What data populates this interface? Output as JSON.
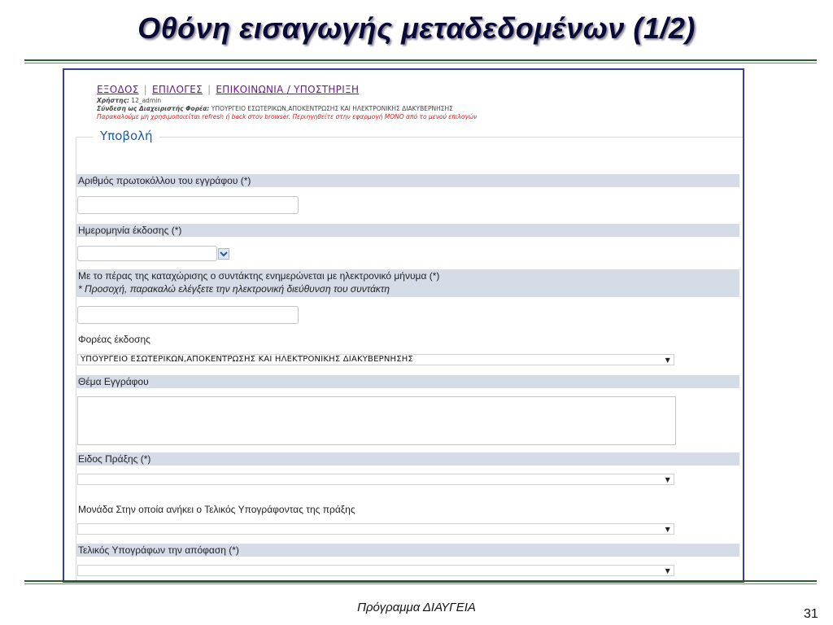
{
  "slide": {
    "title": "Οθόνη εισαγωγής μεταδεδομένων (1/2)",
    "footer": "Πρόγραμμα ΔΙΑΥΓΕΙΑ",
    "page_number": "31"
  },
  "nav": {
    "exit": "ΕΞΟΔΟΣ",
    "options": "ΕΠΙΛΟΓΕΣ",
    "support": "ΕΠΙΚΟΙΝΩΝΙΑ / ΥΠΟΣΤΗΡΙΞΗ",
    "separator": "|"
  },
  "info": {
    "user_label": "Χρήστης:",
    "user_value": "12_admin",
    "org_label": "Σύνδεση ως Διαχειριστής Φορέα:",
    "org_value": "ΥΠΟΥΡΓΕΙΟ ΕΣΩΤΕΡΙΚΩΝ,ΑΠΟΚΕΝΤΡΩΣΗΣ ΚΑΙ ΗΛΕΚΤΡΟΝΙΚΗΣ ΔΙΑΚΥΒΕΡΝΗΣΗΣ",
    "warning": "Παρακαλούμε μη χρησιμοποιείται refresh ή back στον browser. Περιηγηθείτε στην εφαρμογή ΜΟΝΟ από το μενού επιλογών"
  },
  "form": {
    "legend": "Υποβολή",
    "protocol_label": "Αριθμός πρωτοκόλλου του εγγράφου (*)",
    "protocol_value": "",
    "date_label": "Ημερομηνία έκδοσης (*)",
    "date_value": "",
    "email_label": "Με το πέρας της καταχώρισης ο συντάκτης ενημερώνεται με ηλεκτρονικό μήνυμα (*)",
    "email_note": "* Προσοχή, παρακαλώ ελέγξετε την ηλεκτρονική διεύθυνση του συντάκτη",
    "email_value": "",
    "issuer_label": "Φορέας έκδοσης",
    "issuer_value": "ΥΠΟΥΡΓΕΙΟ ΕΣΩΤΕΡΙΚΩΝ,ΑΠΟΚΕΝΤΡΩΣΗΣ ΚΑΙ ΗΛΕΚΤΡΟΝΙΚΗΣ ΔΙΑΚΥΒΕΡΝΗΣΗΣ",
    "subject_label": "Θέμα Εγγράφου",
    "subject_value": "",
    "act_type_label": "Ειδος Πράξης (*)",
    "act_type_value": "",
    "unit_label": "Μονάδα Στην οποία ανήκει ο Τελικός Υπογράφοντας της πράξης",
    "unit_value": "",
    "signer_label": "Τελικός Υπογράφων την απόφαση (*)",
    "signer_value": ""
  },
  "icons": {
    "dropdown": "chevron-down-icon",
    "caret": "▼"
  },
  "colors": {
    "title": "#0a0a3a",
    "rule": "#2e5e2e",
    "frame_border": "#3a3f8f",
    "band": "#d6dbe8",
    "legend": "#1e5aa0",
    "nav_link": "#6a1a8a",
    "warning": "#d02020"
  }
}
